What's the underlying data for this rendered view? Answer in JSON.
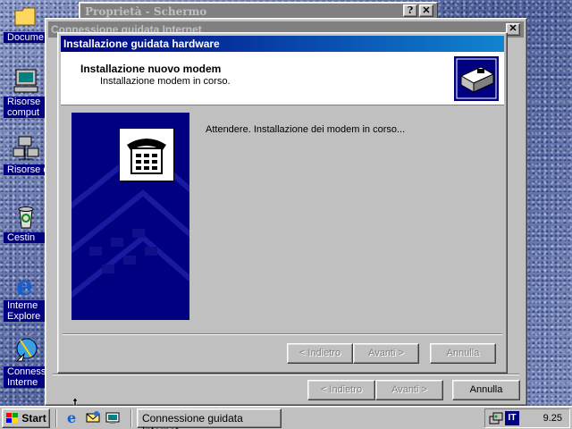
{
  "desktop": {
    "icons": [
      {
        "label": "Docume"
      },
      {
        "label": "Risorse\ncomput"
      },
      {
        "label": "Risorse di"
      },
      {
        "label": "Cestin"
      },
      {
        "label": "Interne\nExplore"
      },
      {
        "label": "Connessi\nInterne"
      }
    ]
  },
  "bg_window": {
    "title": "Proprietà - Schermo",
    "help_label": "?",
    "close_label": "✕"
  },
  "conn_window": {
    "title": "Connessione guidata Internet",
    "close_label": "✕",
    "back_label": "< Indietro",
    "next_label": "Avanti >",
    "cancel_label": "Annulla"
  },
  "dialog": {
    "title": "Installazione guidata hardware",
    "header_title": "Installazione nuovo modem",
    "header_subtitle": "Installazione modem in corso.",
    "message": "Attendere. Installazione dei modem in corso...",
    "back_label": "< Indietro",
    "next_label": "Avanti >",
    "cancel_label": "Annulla"
  },
  "taskbar": {
    "start_label": "Start",
    "task_button_label": "Connessione guidata Internet",
    "tray_lang": "IT",
    "clock": "9.25"
  },
  "colors": {
    "title_active": "#000080",
    "title_inactive": "#808080",
    "face": "#c0c0c0"
  }
}
